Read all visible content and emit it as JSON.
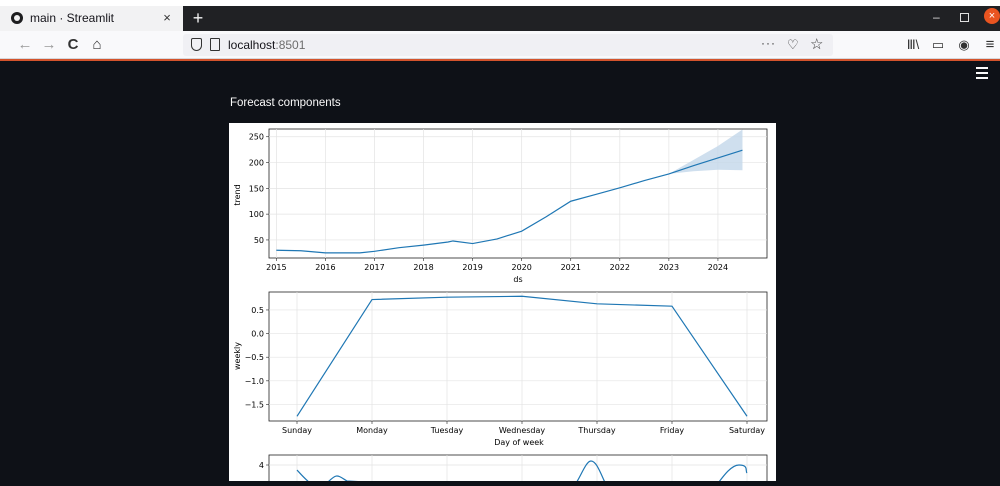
{
  "browser": {
    "tab_title": "main · Streamlit",
    "tab_close": "×",
    "new_tab": "+",
    "url_host": "localhost",
    "url_port": ":8501",
    "url_more": "···",
    "nav_back": "←",
    "nav_forward": "→",
    "nav_reload": "C",
    "nav_home": "⌂",
    "url_pocket": "♡",
    "url_star": "☆",
    "toolbar_library": "Ⅲ\\",
    "toolbar_reader": "▭",
    "toolbar_account": "◉",
    "toolbar_menu": "≡",
    "win_min": "–",
    "win_close": "×"
  },
  "app": {
    "section_title": "Forecast components"
  },
  "colors": {
    "line": "#1f77b4",
    "band": "#c3d7ea",
    "app_bg": "#0e1117",
    "grid": "#e3e3e3"
  },
  "chart_data": [
    {
      "type": "line",
      "ylabel": "trend",
      "xlabel": "ds",
      "x_ticks": [
        "2015",
        "2016",
        "2017",
        "2018",
        "2019",
        "2020",
        "2021",
        "2022",
        "2023",
        "2024"
      ],
      "y_ticks": [
        "50",
        "100",
        "150",
        "200",
        "250"
      ],
      "ylim": [
        15,
        265
      ],
      "x": [
        2015.0,
        2015.5,
        2016.0,
        2016.5,
        2016.7,
        2017.0,
        2017.5,
        2018.0,
        2018.5,
        2018.6,
        2019.0,
        2019.5,
        2020.0,
        2020.5,
        2021.0,
        2021.5,
        2022.0,
        2022.5,
        2023.0,
        2023.5,
        2024.0,
        2024.5
      ],
      "y": [
        30,
        29,
        25,
        25,
        25,
        28,
        35,
        40,
        46,
        48,
        43,
        52,
        67,
        95,
        125,
        138,
        151,
        165,
        178,
        194,
        209,
        224
      ],
      "uncertainty_upper": [
        178,
        205,
        232,
        264
      ],
      "uncertainty_lower": [
        178,
        183,
        186,
        185
      ],
      "uncertainty_x": [
        2023.0,
        2023.5,
        2024.0,
        2024.5
      ],
      "grid": true
    },
    {
      "type": "line",
      "ylabel": "weekly",
      "xlabel": "Day of week",
      "categories": [
        "Sunday",
        "Monday",
        "Tuesday",
        "Wednesday",
        "Thursday",
        "Friday",
        "Saturday"
      ],
      "y_ticks": [
        "0.5",
        "0.0",
        "−0.5",
        "−1.0",
        "−1.5"
      ],
      "ylim": [
        -1.85,
        0.88
      ],
      "values": [
        -1.75,
        0.72,
        0.77,
        0.79,
        0.63,
        0.58,
        -1.75
      ],
      "grid": true
    },
    {
      "type": "line",
      "ylabel": "",
      "y_ticks": [
        "4"
      ],
      "partially_visible": true,
      "grid": true
    }
  ]
}
